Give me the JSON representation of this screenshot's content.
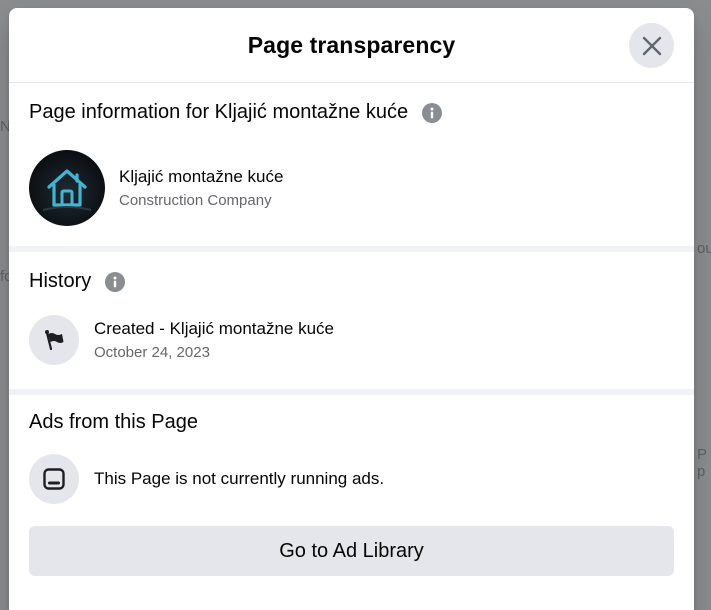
{
  "dialog": {
    "title": "Page transparency"
  },
  "page_info": {
    "heading": "Page information for Kljajić montažne kuće",
    "page_name": "Kljajić montažne kuće",
    "page_category": "Construction Company"
  },
  "history": {
    "heading": "History",
    "event_title": "Created - Kljajić montažne kuće",
    "event_date": "October 24, 2023"
  },
  "ads": {
    "heading": "Ads from this Page",
    "status_text": "This Page is not currently running ads.",
    "library_button_label": "Go to Ad Library"
  },
  "icons": {
    "close": "close-icon",
    "info": "info-icon",
    "flag": "flag-icon",
    "ads": "tablet-icon",
    "avatar": "house-logo-icon"
  },
  "colors": {
    "dialog_bg": "#ffffff",
    "backdrop": "#8c8d8f",
    "secondary_button_bg": "#e4e6eb",
    "primary_text": "#050505",
    "secondary_text": "#65676b",
    "divider": "#f0f2f5",
    "logo_accent": "#3fb6d3"
  }
}
